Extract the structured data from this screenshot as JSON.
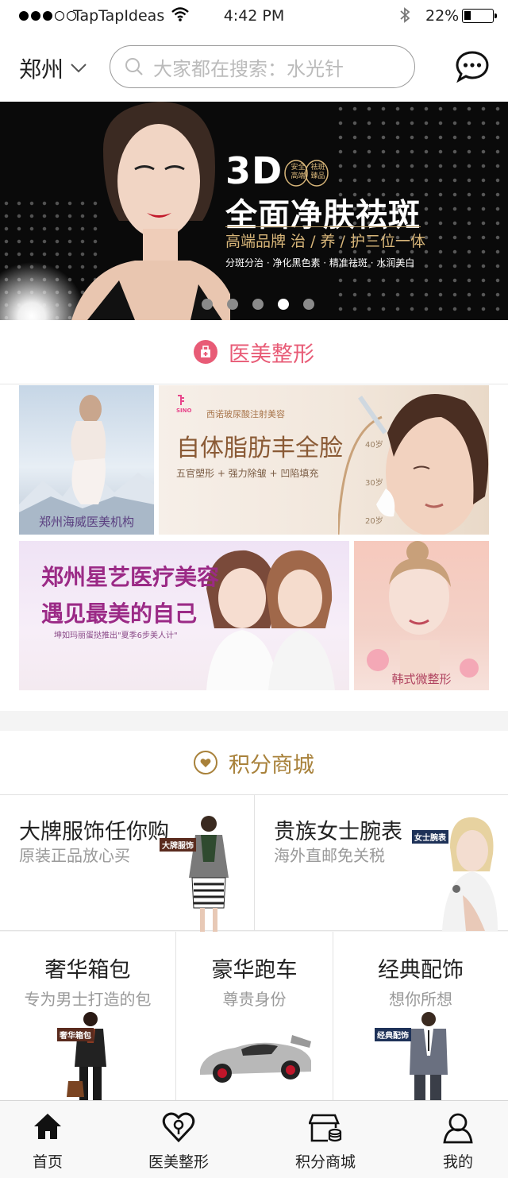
{
  "status": {
    "carrier": "TapTapIdeas",
    "time": "4:42 PM",
    "battery": "22%",
    "signal_bars_filled": 3,
    "battery_level": 0.22
  },
  "header": {
    "city": "郑州",
    "search_placeholder": "大家都在搜索：水光针"
  },
  "banner": {
    "headline_3d": "3D",
    "badge_lines": [
      "安全",
      "祛斑",
      "高端",
      "臻品"
    ],
    "headline": "全面净肤祛斑",
    "tagline": "高端品牌  治 / 养 / 护三位一体",
    "features": "分斑分治 · 净化黑色素 · 精准祛斑 · 水润美白",
    "slides": 5,
    "active_slide": 4
  },
  "medical": {
    "title": "医美整形",
    "tiles": [
      {
        "label": "郑州海威医美机构"
      },
      {
        "brand": "SINO",
        "small": "西诺玻尿酸注射美容",
        "title": "自体脂肪丰全脸",
        "sub": "五官塑形 + 强力除皱 + 凹陷填充",
        "scale": [
          "40岁",
          "30岁",
          "20岁"
        ]
      },
      {
        "title1": "郑州星艺医疗美容",
        "title2": "遇见最美的自己",
        "sub": "坤如玛丽蛋挞推出\"夏季6步美人计\""
      },
      {
        "label": "韩式微整形"
      }
    ]
  },
  "mall": {
    "title": "积分商城",
    "row1": [
      {
        "title": "大牌服饰任你购",
        "sub": "原装正品放心买",
        "tag": "大牌服饰"
      },
      {
        "title": "贵族女士腕表",
        "sub": "海外直邮免关税",
        "tag": "女士腕表"
      }
    ],
    "row2": [
      {
        "title": "奢华箱包",
        "sub": "专为男士打造的包",
        "tag": "奢华箱包"
      },
      {
        "title": "豪华跑车",
        "sub": "尊贵身份"
      },
      {
        "title": "经典配饰",
        "sub": "想你所想",
        "tag": "经典配饰"
      }
    ]
  },
  "tabbar": [
    {
      "label": "首页"
    },
    {
      "label": "医美整形"
    },
    {
      "label": "积分商城"
    },
    {
      "label": "我的"
    }
  ],
  "colors": {
    "medical_accent": "#e85b76",
    "mall_accent": "#a8813a",
    "banner_gold": "#d9b77a"
  }
}
